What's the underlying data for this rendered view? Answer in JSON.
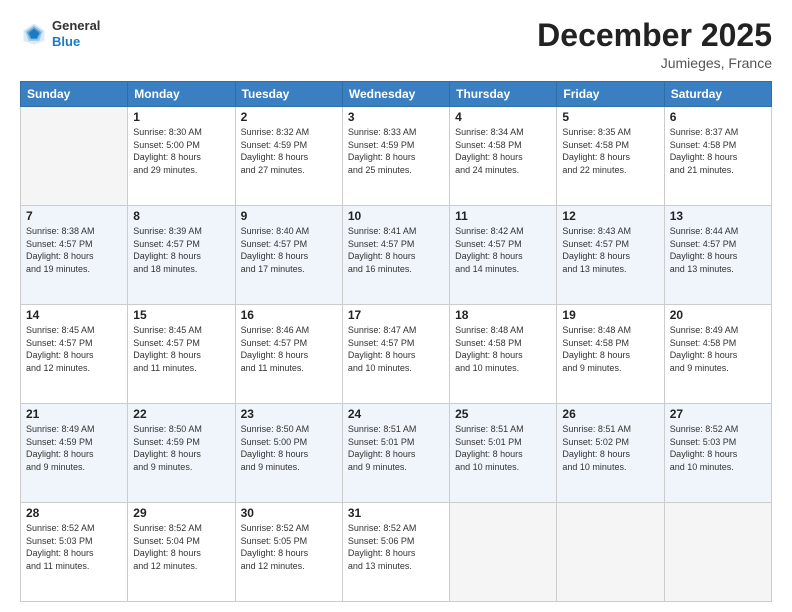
{
  "header": {
    "logo": {
      "general": "General",
      "blue": "Blue"
    },
    "title": "December 2025",
    "location": "Jumieges, France"
  },
  "weekdays": [
    "Sunday",
    "Monday",
    "Tuesday",
    "Wednesday",
    "Thursday",
    "Friday",
    "Saturday"
  ],
  "weeks": [
    [
      {
        "day": "",
        "info": ""
      },
      {
        "day": "1",
        "info": "Sunrise: 8:30 AM\nSunset: 5:00 PM\nDaylight: 8 hours\nand 29 minutes."
      },
      {
        "day": "2",
        "info": "Sunrise: 8:32 AM\nSunset: 4:59 PM\nDaylight: 8 hours\nand 27 minutes."
      },
      {
        "day": "3",
        "info": "Sunrise: 8:33 AM\nSunset: 4:59 PM\nDaylight: 8 hours\nand 25 minutes."
      },
      {
        "day": "4",
        "info": "Sunrise: 8:34 AM\nSunset: 4:58 PM\nDaylight: 8 hours\nand 24 minutes."
      },
      {
        "day": "5",
        "info": "Sunrise: 8:35 AM\nSunset: 4:58 PM\nDaylight: 8 hours\nand 22 minutes."
      },
      {
        "day": "6",
        "info": "Sunrise: 8:37 AM\nSunset: 4:58 PM\nDaylight: 8 hours\nand 21 minutes."
      }
    ],
    [
      {
        "day": "7",
        "info": "Sunrise: 8:38 AM\nSunset: 4:57 PM\nDaylight: 8 hours\nand 19 minutes."
      },
      {
        "day": "8",
        "info": "Sunrise: 8:39 AM\nSunset: 4:57 PM\nDaylight: 8 hours\nand 18 minutes."
      },
      {
        "day": "9",
        "info": "Sunrise: 8:40 AM\nSunset: 4:57 PM\nDaylight: 8 hours\nand 17 minutes."
      },
      {
        "day": "10",
        "info": "Sunrise: 8:41 AM\nSunset: 4:57 PM\nDaylight: 8 hours\nand 16 minutes."
      },
      {
        "day": "11",
        "info": "Sunrise: 8:42 AM\nSunset: 4:57 PM\nDaylight: 8 hours\nand 14 minutes."
      },
      {
        "day": "12",
        "info": "Sunrise: 8:43 AM\nSunset: 4:57 PM\nDaylight: 8 hours\nand 13 minutes."
      },
      {
        "day": "13",
        "info": "Sunrise: 8:44 AM\nSunset: 4:57 PM\nDaylight: 8 hours\nand 13 minutes."
      }
    ],
    [
      {
        "day": "14",
        "info": "Sunrise: 8:45 AM\nSunset: 4:57 PM\nDaylight: 8 hours\nand 12 minutes."
      },
      {
        "day": "15",
        "info": "Sunrise: 8:45 AM\nSunset: 4:57 PM\nDaylight: 8 hours\nand 11 minutes."
      },
      {
        "day": "16",
        "info": "Sunrise: 8:46 AM\nSunset: 4:57 PM\nDaylight: 8 hours\nand 11 minutes."
      },
      {
        "day": "17",
        "info": "Sunrise: 8:47 AM\nSunset: 4:57 PM\nDaylight: 8 hours\nand 10 minutes."
      },
      {
        "day": "18",
        "info": "Sunrise: 8:48 AM\nSunset: 4:58 PM\nDaylight: 8 hours\nand 10 minutes."
      },
      {
        "day": "19",
        "info": "Sunrise: 8:48 AM\nSunset: 4:58 PM\nDaylight: 8 hours\nand 9 minutes."
      },
      {
        "day": "20",
        "info": "Sunrise: 8:49 AM\nSunset: 4:58 PM\nDaylight: 8 hours\nand 9 minutes."
      }
    ],
    [
      {
        "day": "21",
        "info": "Sunrise: 8:49 AM\nSunset: 4:59 PM\nDaylight: 8 hours\nand 9 minutes."
      },
      {
        "day": "22",
        "info": "Sunrise: 8:50 AM\nSunset: 4:59 PM\nDaylight: 8 hours\nand 9 minutes."
      },
      {
        "day": "23",
        "info": "Sunrise: 8:50 AM\nSunset: 5:00 PM\nDaylight: 8 hours\nand 9 minutes."
      },
      {
        "day": "24",
        "info": "Sunrise: 8:51 AM\nSunset: 5:01 PM\nDaylight: 8 hours\nand 9 minutes."
      },
      {
        "day": "25",
        "info": "Sunrise: 8:51 AM\nSunset: 5:01 PM\nDaylight: 8 hours\nand 10 minutes."
      },
      {
        "day": "26",
        "info": "Sunrise: 8:51 AM\nSunset: 5:02 PM\nDaylight: 8 hours\nand 10 minutes."
      },
      {
        "day": "27",
        "info": "Sunrise: 8:52 AM\nSunset: 5:03 PM\nDaylight: 8 hours\nand 10 minutes."
      }
    ],
    [
      {
        "day": "28",
        "info": "Sunrise: 8:52 AM\nSunset: 5:03 PM\nDaylight: 8 hours\nand 11 minutes."
      },
      {
        "day": "29",
        "info": "Sunrise: 8:52 AM\nSunset: 5:04 PM\nDaylight: 8 hours\nand 12 minutes."
      },
      {
        "day": "30",
        "info": "Sunrise: 8:52 AM\nSunset: 5:05 PM\nDaylight: 8 hours\nand 12 minutes."
      },
      {
        "day": "31",
        "info": "Sunrise: 8:52 AM\nSunset: 5:06 PM\nDaylight: 8 hours\nand 13 minutes."
      },
      {
        "day": "",
        "info": ""
      },
      {
        "day": "",
        "info": ""
      },
      {
        "day": "",
        "info": ""
      }
    ]
  ]
}
